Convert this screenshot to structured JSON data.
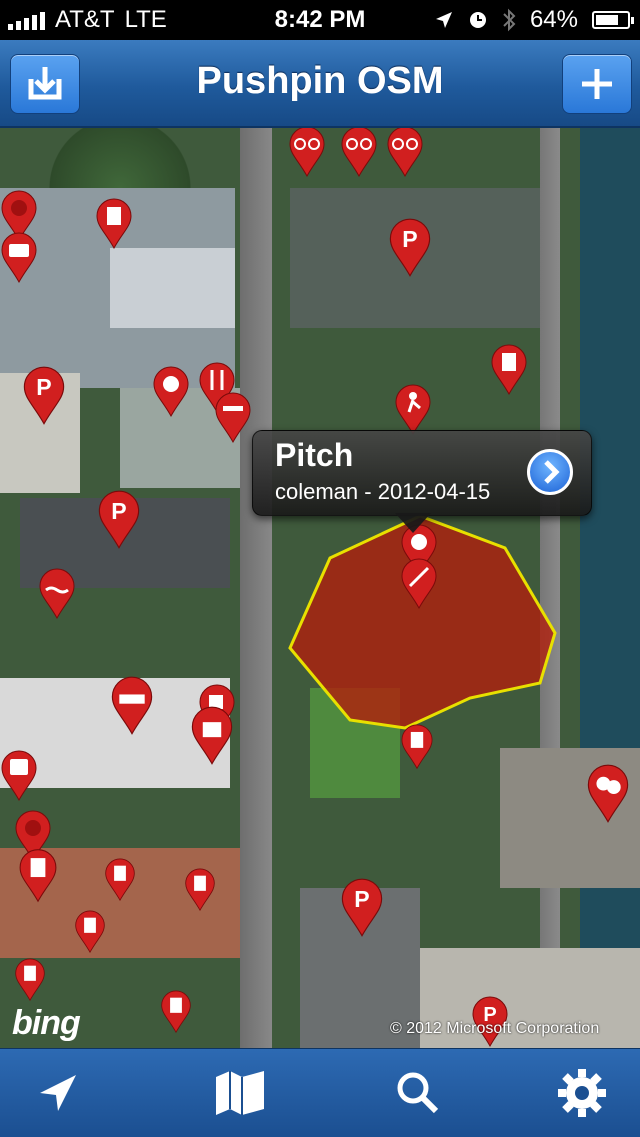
{
  "status_bar": {
    "carrier": "AT&T",
    "network": "LTE",
    "time": "8:42 PM",
    "battery": "64%"
  },
  "navbar": {
    "title": "Pushpin OSM",
    "left_button_icon": "download-icon",
    "right_button_icon": "plus-icon"
  },
  "map": {
    "callout": {
      "title": "Pitch",
      "subtitle": "coleman - 2012-04-15",
      "accessory_icon": "chevron-right-disclosure-icon"
    },
    "attribution_logo": "bing",
    "copyright": "© 2012 Microsoft Corporation",
    "pin_color": "#d11f1f",
    "highlight_color": "#b01f0c"
  },
  "toolbar": {
    "items": [
      {
        "icon": "location-arrow-icon"
      },
      {
        "icon": "map-icon"
      },
      {
        "icon": "search-icon"
      },
      {
        "icon": "gear-icon"
      }
    ]
  }
}
